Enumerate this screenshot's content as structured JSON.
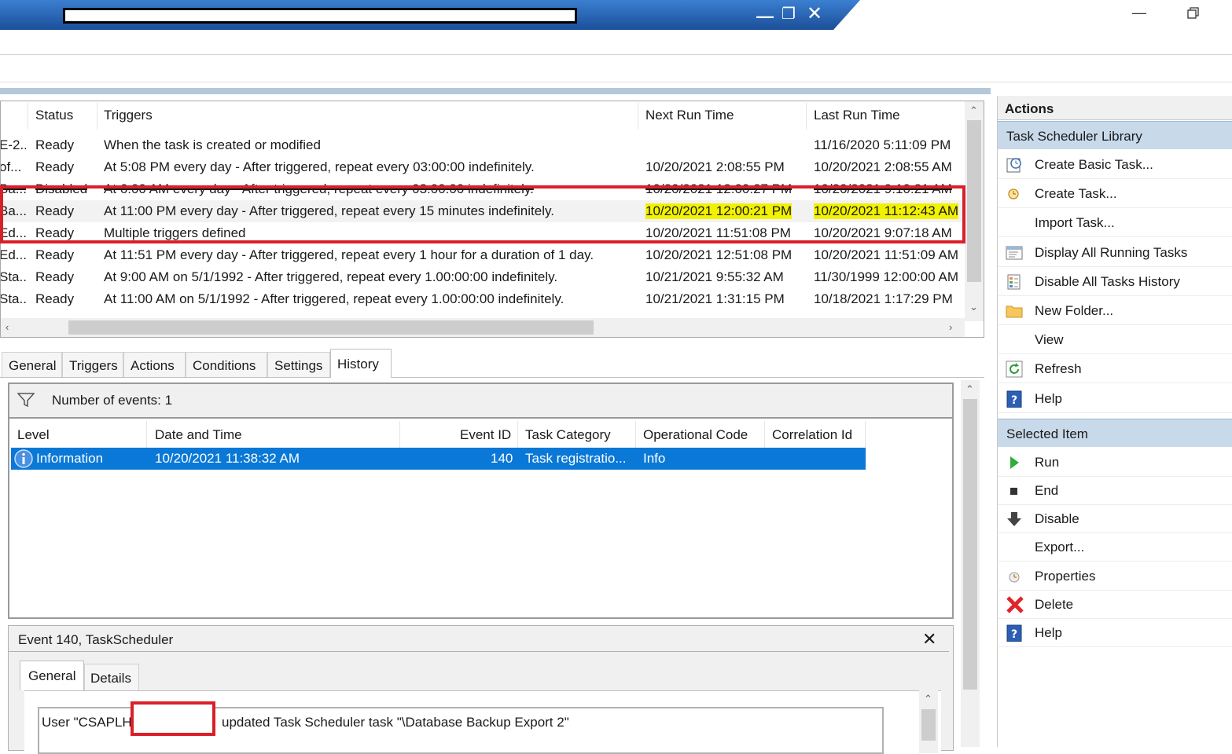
{
  "actions": {
    "groups": [
      {
        "header": "Task Scheduler Library",
        "items": [
          {
            "label": "Create Basic Task...",
            "icon": "create-basic-task-icon"
          },
          {
            "label": "Create Task...",
            "icon": "create-task-icon"
          },
          {
            "label": "Import Task...",
            "icon": ""
          },
          {
            "label": "Display All Running Tasks",
            "icon": "running-tasks-icon"
          },
          {
            "label": "Disable All Tasks History",
            "icon": "history-icon"
          },
          {
            "label": "New Folder...",
            "icon": "folder-icon"
          },
          {
            "label": "View",
            "icon": ""
          },
          {
            "label": "Refresh",
            "icon": "refresh-icon"
          },
          {
            "label": "Help",
            "icon": "help-icon"
          }
        ]
      },
      {
        "header": "Selected Item",
        "items": [
          {
            "label": "Run",
            "icon": "run-icon"
          },
          {
            "label": "End",
            "icon": "end-icon"
          },
          {
            "label": "Disable",
            "icon": "disable-icon"
          },
          {
            "label": "Export...",
            "icon": ""
          },
          {
            "label": "Properties",
            "icon": "properties-icon"
          },
          {
            "label": "Delete",
            "icon": "delete-icon"
          },
          {
            "label": "Help",
            "icon": "help-icon"
          }
        ]
      }
    ],
    "title": "Actions"
  },
  "tasks": {
    "columns": {
      "status": "Status",
      "triggers": "Triggers",
      "next": "Next Run Time",
      "last": "Last Run Time"
    },
    "rows": [
      {
        "name": "E-2...",
        "status": "Ready",
        "triggers": "When the task is created or modified",
        "next": "",
        "last": "11/16/2020 5:11:09 PM"
      },
      {
        "name": "of...",
        "status": "Ready",
        "triggers": "At 5:08 PM every day - After triggered, repeat every 03:00:00 indefinitely.",
        "next": "10/20/2021 2:08:55 PM",
        "last": "10/20/2021 2:08:55 AM"
      },
      {
        "name": "Ba...",
        "status": "Disabled",
        "triggers": "At 6:00 AM every day - After triggered, repeat every 03:00:00 indefinitely.",
        "next": "10/20/2021 12:00:27 PM",
        "last": "10/20/2021 9:10:21 AM"
      },
      {
        "name": "Ba...",
        "status": "Ready",
        "triggers": "At 11:00 PM every day - After triggered, repeat every 15 minutes indefinitely.",
        "next": "10/20/2021 12:00:21 PM",
        "last": "10/20/2021 11:12:43 AM"
      },
      {
        "name": "Ed...",
        "status": "Ready",
        "triggers": "Multiple triggers defined",
        "next": "10/20/2021 11:51:08 PM",
        "last": "10/20/2021 9:07:18 AM"
      },
      {
        "name": "Ed...",
        "status": "Ready",
        "triggers": "At 11:51 PM every day - After triggered, repeat every 1 hour for a duration of 1 day.",
        "next": "10/20/2021 12:51:08 PM",
        "last": "10/20/2021 11:51:09 AM"
      },
      {
        "name": "Sta...",
        "status": "Ready",
        "triggers": "At 9:00 AM on 5/1/1992 - After triggered, repeat every 1.00:00:00 indefinitely.",
        "next": "10/21/2021 9:55:32 AM",
        "last": "11/30/1999 12:00:00 AM"
      },
      {
        "name": "Sta...",
        "status": "Ready",
        "triggers": "At 11:00 AM on 5/1/1992 - After triggered, repeat every 1.00:00:00 indefinitely.",
        "next": "10/21/2021 1:31:15 PM",
        "last": "10/18/2021 1:17:29 PM"
      }
    ]
  },
  "tabs": [
    "General",
    "Triggers",
    "Actions",
    "Conditions",
    "Settings",
    "History"
  ],
  "history": {
    "count_label": "Number of events: 1",
    "columns": {
      "level": "Level",
      "date": "Date and Time",
      "id": "Event ID",
      "category": "Task Category",
      "opcode": "Operational Code",
      "corr": "Correlation Id"
    },
    "row": {
      "level": "Information",
      "date": "10/20/2021 11:38:32 AM",
      "id": "140",
      "category": "Task registratio...",
      "opcode": "Info",
      "corr": ""
    }
  },
  "detail": {
    "title": "Event 140, TaskScheduler",
    "tabs": [
      "General",
      "Details"
    ],
    "message_prefix": "User \"CSAPLH",
    "message_suffix": "updated Task Scheduler task \"\\Database Backup Export 2\""
  },
  "colors": {
    "accent": "#0a78d7",
    "highlight": "#f2f200",
    "redbox": "#d9202a",
    "title_blue": "#1f5fb3"
  }
}
